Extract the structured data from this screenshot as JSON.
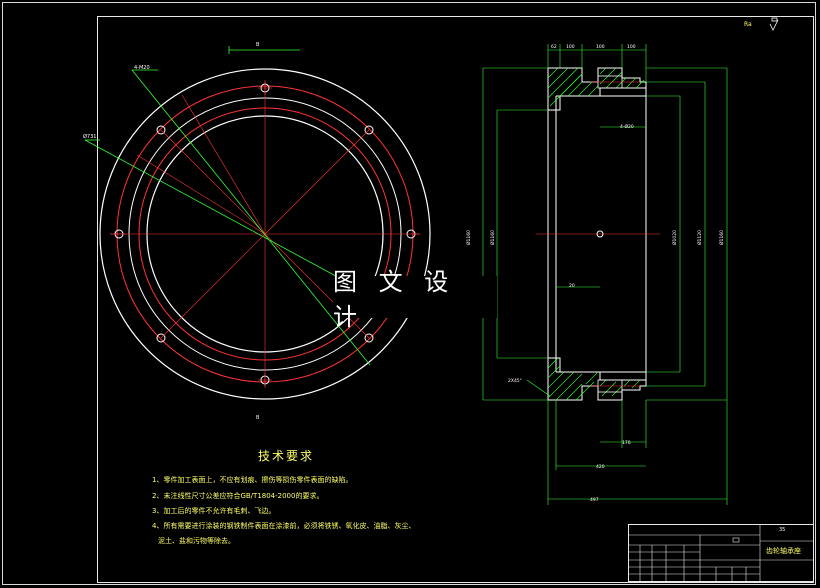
{
  "watermark": "图 文 设 计",
  "technical_requirements": {
    "title": "技术要求",
    "items": [
      "1、零件加工表面上，不应有划痕、擦伤等损伤零件表面的缺陷。",
      "2、未注线性尺寸公差应符合GB/T1804-2000的要求。",
      "3、加工后的零件不允许有毛刺、飞边。",
      "4、所有需要进行涂装的钢铁制件表面在涂漆前，必须将铁锈、氧化皮、油脂、灰尘、",
      "泥土、盐和污物等除去。"
    ]
  },
  "title_block": {
    "part_name": "齿轮轴承座",
    "code": "35"
  },
  "surface_note": "Ra",
  "section_mark": "B",
  "dimensions": {
    "top_1": "62",
    "top_2": "100",
    "top_3": "100",
    "top_4": "100",
    "bolt_label": "4-M20",
    "pcd_label": "Ø731",
    "hole_label": "4-Ø20",
    "left_1": "Ø1160",
    "left_2": "Ø1160",
    "mid_1": "Ø1265",
    "right_1": "Ø1020",
    "right_2": "Ø1120",
    "right_3": "Ø1160",
    "chamfer": "2X45°",
    "small": "20",
    "bottom_1": "170",
    "bottom_2": "420",
    "bottom_3": "497"
  },
  "colors": {
    "outline": "#ffffff",
    "hidden": "#ff3333",
    "dimension": "#33ff33",
    "note": "#ffff66",
    "frame": "#e8e8e8",
    "hatch": "#33ff33"
  }
}
